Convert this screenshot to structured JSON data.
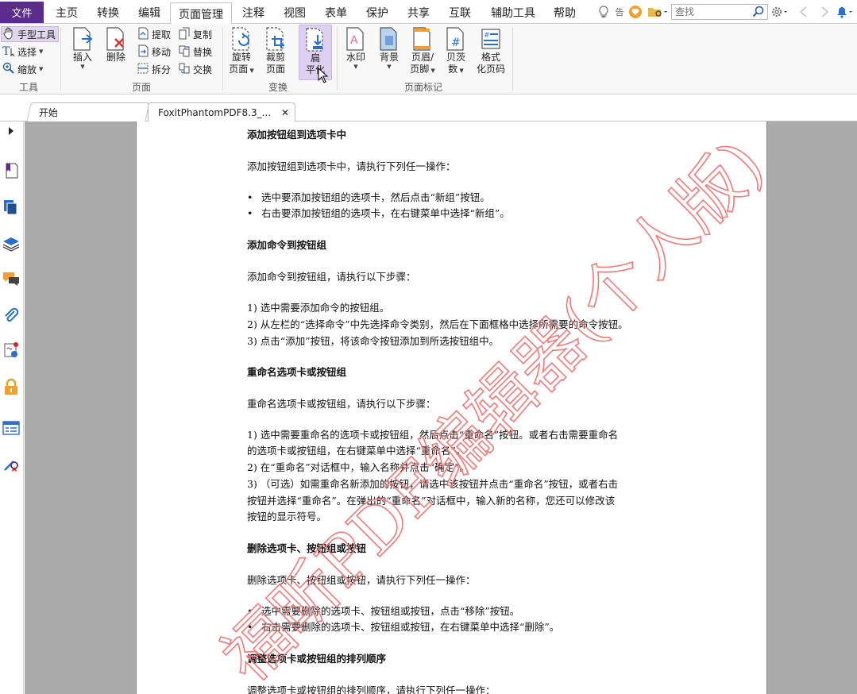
{
  "menu": {
    "file": "文件",
    "items": [
      "主页",
      "转换",
      "编辑",
      "页面管理",
      "注释",
      "视图",
      "表单",
      "保护",
      "共享",
      "互联",
      "辅助工具",
      "帮助"
    ],
    "active": "页面管理",
    "quick_text": "告",
    "search_placeholder": "查找"
  },
  "ribbon": {
    "tools": {
      "hand": "手型工具",
      "select": "选择",
      "zoom": "缩放",
      "label": "工具"
    },
    "pages": {
      "insert": "插入",
      "delete": "删除",
      "extract": "提取",
      "move": "移动",
      "split": "拆分",
      "copy": "复制",
      "replace": "替换",
      "swap": "交换",
      "label": "页面"
    },
    "transform": {
      "rotate1": "旋转",
      "rotate2": "页面",
      "crop1": "裁剪",
      "crop2": "页面",
      "flatten1": "扁",
      "flatten2": "平化",
      "label": "变换"
    },
    "marks": {
      "watermark": "水印",
      "background": "背景",
      "header1": "页眉/",
      "header2": "页脚",
      "bates1": "贝茨",
      "bates2": "数",
      "format1": "格式",
      "format2": "化页码",
      "label": "页面标记"
    }
  },
  "tabs": [
    "开始",
    "FoxitPhantomPDF8.3_..."
  ],
  "document": {
    "lines": [
      {
        "text": "添加按钮组到选项卡中",
        "type": "h"
      },
      {
        "text": "添加按钮组到选项卡中，请执行下列任一操作：",
        "type": "p"
      },
      {
        "text": "选中要添加按钮组的选项卡，然后点击“新组”按钮。",
        "type": "b"
      },
      {
        "text": "右击要添加按钮组的选项卡，在右键菜单中选择“新组”。",
        "type": "b"
      },
      {
        "text": "添加命令到按钮组",
        "type": "h"
      },
      {
        "text": "添加命令到按钮组，请执行以下步骤：",
        "type": "p"
      },
      {
        "text": "1)  选中需要添加命令的按钮组。",
        "type": "p"
      },
      {
        "text": "2)  从左栏的“选择命令”中先选择命令类别，然后在下面框格中选择所需要的命令按钮。",
        "type": "p"
      },
      {
        "text": "3)  点击“添加”按钮，将该命令按钮添加到所选按钮组中。",
        "type": "p"
      },
      {
        "text": "重命名选项卡或按钮组",
        "type": "h"
      },
      {
        "text": "重命名选项卡或按钮组，请执行以下步骤：",
        "type": "p"
      },
      {
        "text": "1)  选中需要重命名的选项卡或按钮组，然后点击“重命名”按钮。或者右击需要重命名",
        "type": "p"
      },
      {
        "text": "的选项卡或按钮组，在右键菜单中选择“重命名”。",
        "type": "p"
      },
      {
        "text": "2)  在“重命名”对话框中，输入名称并点击“确定”。",
        "type": "p"
      },
      {
        "text": "3)  （可选）如需重命名新添加的按钮，请选中该按钮并点击“重命名”按钮，或者右击",
        "type": "p"
      },
      {
        "text": "按钮并选择“重命名”。在弹出的“重命名”对话框中，输入新的名称，您还可以修改该",
        "type": "p"
      },
      {
        "text": "按钮的显示符号。",
        "type": "p"
      },
      {
        "text": "删除选项卡、按钮组或按钮",
        "type": "h"
      },
      {
        "text": "删除选项卡、按钮组或按钮，请执行下列任一操作：",
        "type": "p"
      },
      {
        "text": "选中需要删除的选项卡、按钮组或按钮，点击“移除”按钮。",
        "type": "b"
      },
      {
        "text": "右击需要删除的选项卡、按钮组或按钮，在右键菜单中选择“删除”。",
        "type": "b"
      },
      {
        "text": "调整选项卡或按钮组的排列顺序",
        "type": "h"
      },
      {
        "text": "调整选项卡或按钮组的排列顺序，请执行下列任一操作：",
        "type": "p"
      }
    ]
  },
  "watermark": "福昕PDF编辑器(个人版)",
  "colors": {
    "accent": "#5a2d8c",
    "watermark": "#f07a7a",
    "viewer_bg": "#ababab"
  }
}
